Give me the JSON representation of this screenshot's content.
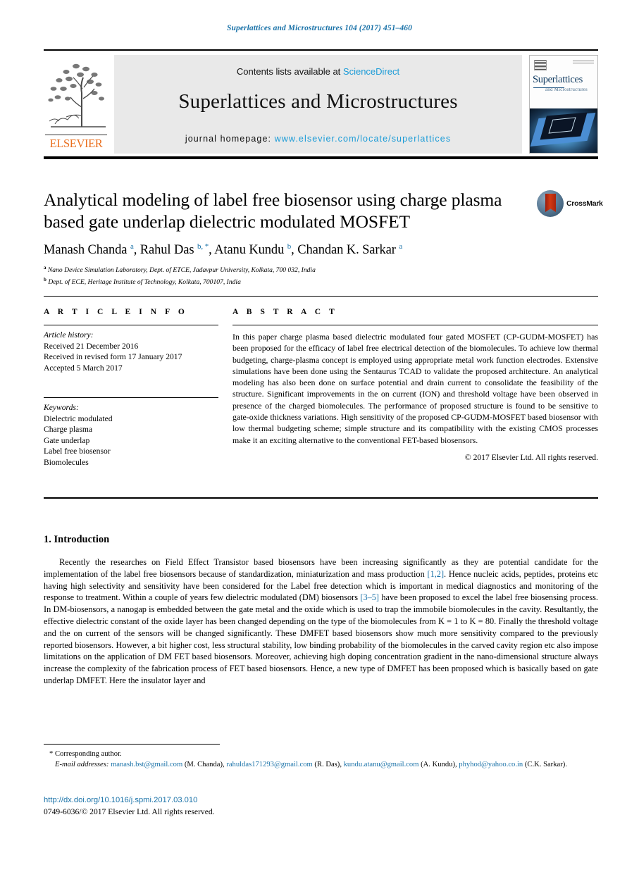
{
  "running_head": "Superlattices and Microstructures 104 (2017) 451–460",
  "masthead": {
    "contents_prefix": "Contents lists available at ",
    "sciencedirect": "ScienceDirect",
    "journal_title": "Superlattices and Microstructures",
    "homepage_prefix": "journal homepage: ",
    "homepage_url": "www.elsevier.com/locate/superlattices",
    "publisher_wordmark": "ELSEVIER",
    "cover": {
      "title": "Superlattices",
      "subtitle": "and Microstructures"
    }
  },
  "crossmark": {
    "label": "CrossMark"
  },
  "article": {
    "title": "Analytical modeling of label free biosensor using charge plasma based gate underlap dielectric modulated MOSFET",
    "authors_html": "Manash Chanda <sup>a</sup>, Rahul Das <sup>b, *</sup>, Atanu Kundu <sup>b</sup>, Chandan K. Sarkar <sup>a</sup>",
    "affiliations": [
      {
        "marker": "a",
        "text": "Nano Device Simulation Laboratory, Dept. of ETCE, Jadavpur University, Kolkata, 700 032, India"
      },
      {
        "marker": "b",
        "text": "Dept. of ECE, Heritage Institute of Technology, Kolkata, 700107, India"
      }
    ]
  },
  "article_info": {
    "heading": "A R T I C L E  I N F O",
    "history_label": "Article history:",
    "history": [
      "Received 21 December 2016",
      "Received in revised form 17 January 2017",
      "Accepted 5 March 2017"
    ],
    "keywords_label": "Keywords:",
    "keywords": [
      "Dielectric modulated",
      "Charge plasma",
      "Gate underlap",
      "Label free biosensor",
      "Biomolecules"
    ]
  },
  "abstract": {
    "heading": "A B S T R A C T",
    "text": "In this paper charge plasma based dielectric modulated four gated MOSFET (CP-GUDM-MOSFET) has been proposed for the efficacy of label free electrical detection of the biomolecules. To achieve low thermal budgeting, charge-plasma concept is employed using appropriate metal work function electrodes. Extensive simulations have been done using the Sentaurus TCAD to validate the proposed architecture. An analytical modeling has also been done on surface potential and drain current to consolidate the feasibility of the structure. Significant improvements in the on current (ION) and threshold voltage have been observed in presence of the charged biomolecules. The performance of proposed structure is found to be sensitive to gate-oxide thickness variations. High sensitivity of the proposed CP-GUDM-MOSFET based biosensor with low thermal budgeting scheme; simple structure and its compatibility with the existing CMOS processes make it an exciting alternative to the conventional FET-based biosensors.",
    "copyright": "© 2017 Elsevier Ltd. All rights reserved."
  },
  "body": {
    "section_title": "1. Introduction",
    "paragraph_parts": {
      "p1": "Recently the researches on Field Effect Transistor based biosensors have been increasing significantly as they are potential candidate for the implementation of the label free biosensors because of standardization, miniaturization and mass production ",
      "cite1": "[1,2]",
      "p2": ". Hence nucleic acids, peptides, proteins etc having high selectivity and sensitivity have been considered for the Label free detection which is important in medical diagnostics and monitoring of the response to treatment. Within a couple of years few dielectric modulated (DM) biosensors ",
      "cite2": "[3–5]",
      "p3": " have been proposed to excel the label free biosensing process. In DM-biosensors, a nanogap is embedded between the gate metal and the oxide which is used to trap the immobile biomolecules in the cavity. Resultantly, the effective dielectric constant of the oxide layer has been changed depending on the type of the biomolecules from K = 1 to K = 80. Finally the threshold voltage and the on current of the sensors will be changed significantly. These DMFET based biosensors show much more sensitivity compared to the previously reported biosensors. However, a bit higher cost, less structural stability, low binding probability of the biomolecules in the carved cavity region etc also impose limitations on the application of DM FET based biosensors. Moreover, achieving high doping concentration gradient in the nano-dimensional structure always increase the complexity of the fabrication process of FET based biosensors. Hence, a new type of DMFET has been proposed which is basically based on gate underlap DMFET. Here the insulator layer and"
    }
  },
  "footnotes": {
    "corresponding": "* Corresponding author.",
    "email_label": "E-mail addresses:",
    "emails": [
      {
        "address": "manash.bst@gmail.com",
        "owner": "(M. Chanda)"
      },
      {
        "address": "rahuldas171293@gmail.com",
        "owner": "(R. Das)"
      },
      {
        "address": "kundu.atanu@gmail.com",
        "owner": "(A. Kundu)"
      },
      {
        "address": "phyhod@yahoo.co.in",
        "owner": "(C.K. Sarkar)"
      }
    ],
    "doi": "http://dx.doi.org/10.1016/j.spmi.2017.03.010",
    "issn": "0749-6036/© 2017 Elsevier Ltd. All rights reserved."
  },
  "colors": {
    "link": "#1a72a8",
    "sciencedirect": "#1a9bd7",
    "elsevier_orange": "#ea6f1e"
  }
}
